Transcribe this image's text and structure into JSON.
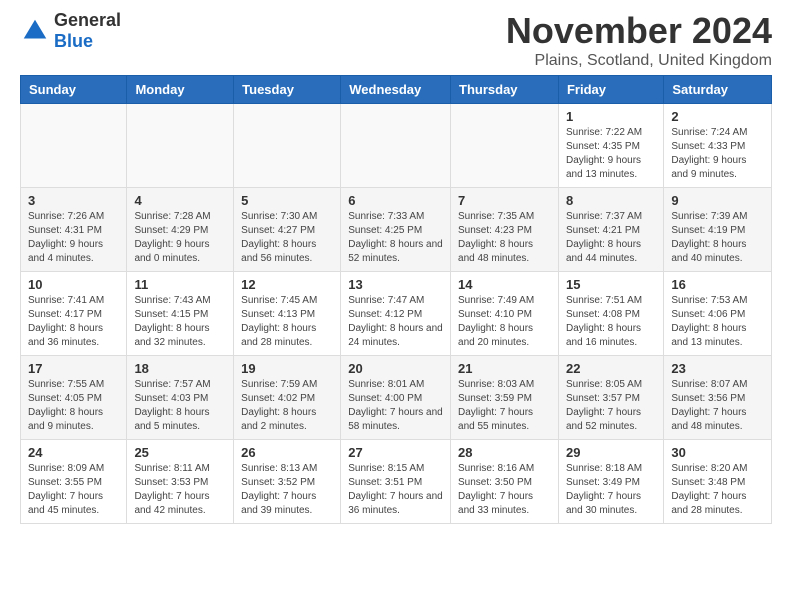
{
  "header": {
    "logo": {
      "general": "General",
      "blue": "Blue"
    },
    "title": "November 2024",
    "location": "Plains, Scotland, United Kingdom"
  },
  "calendar": {
    "days_of_week": [
      "Sunday",
      "Monday",
      "Tuesday",
      "Wednesday",
      "Thursday",
      "Friday",
      "Saturday"
    ],
    "weeks": [
      [
        {
          "day": "",
          "info": ""
        },
        {
          "day": "",
          "info": ""
        },
        {
          "day": "",
          "info": ""
        },
        {
          "day": "",
          "info": ""
        },
        {
          "day": "",
          "info": ""
        },
        {
          "day": "1",
          "info": "Sunrise: 7:22 AM\nSunset: 4:35 PM\nDaylight: 9 hours and 13 minutes."
        },
        {
          "day": "2",
          "info": "Sunrise: 7:24 AM\nSunset: 4:33 PM\nDaylight: 9 hours and 9 minutes."
        }
      ],
      [
        {
          "day": "3",
          "info": "Sunrise: 7:26 AM\nSunset: 4:31 PM\nDaylight: 9 hours and 4 minutes."
        },
        {
          "day": "4",
          "info": "Sunrise: 7:28 AM\nSunset: 4:29 PM\nDaylight: 9 hours and 0 minutes."
        },
        {
          "day": "5",
          "info": "Sunrise: 7:30 AM\nSunset: 4:27 PM\nDaylight: 8 hours and 56 minutes."
        },
        {
          "day": "6",
          "info": "Sunrise: 7:33 AM\nSunset: 4:25 PM\nDaylight: 8 hours and 52 minutes."
        },
        {
          "day": "7",
          "info": "Sunrise: 7:35 AM\nSunset: 4:23 PM\nDaylight: 8 hours and 48 minutes."
        },
        {
          "day": "8",
          "info": "Sunrise: 7:37 AM\nSunset: 4:21 PM\nDaylight: 8 hours and 44 minutes."
        },
        {
          "day": "9",
          "info": "Sunrise: 7:39 AM\nSunset: 4:19 PM\nDaylight: 8 hours and 40 minutes."
        }
      ],
      [
        {
          "day": "10",
          "info": "Sunrise: 7:41 AM\nSunset: 4:17 PM\nDaylight: 8 hours and 36 minutes."
        },
        {
          "day": "11",
          "info": "Sunrise: 7:43 AM\nSunset: 4:15 PM\nDaylight: 8 hours and 32 minutes."
        },
        {
          "day": "12",
          "info": "Sunrise: 7:45 AM\nSunset: 4:13 PM\nDaylight: 8 hours and 28 minutes."
        },
        {
          "day": "13",
          "info": "Sunrise: 7:47 AM\nSunset: 4:12 PM\nDaylight: 8 hours and 24 minutes."
        },
        {
          "day": "14",
          "info": "Sunrise: 7:49 AM\nSunset: 4:10 PM\nDaylight: 8 hours and 20 minutes."
        },
        {
          "day": "15",
          "info": "Sunrise: 7:51 AM\nSunset: 4:08 PM\nDaylight: 8 hours and 16 minutes."
        },
        {
          "day": "16",
          "info": "Sunrise: 7:53 AM\nSunset: 4:06 PM\nDaylight: 8 hours and 13 minutes."
        }
      ],
      [
        {
          "day": "17",
          "info": "Sunrise: 7:55 AM\nSunset: 4:05 PM\nDaylight: 8 hours and 9 minutes."
        },
        {
          "day": "18",
          "info": "Sunrise: 7:57 AM\nSunset: 4:03 PM\nDaylight: 8 hours and 5 minutes."
        },
        {
          "day": "19",
          "info": "Sunrise: 7:59 AM\nSunset: 4:02 PM\nDaylight: 8 hours and 2 minutes."
        },
        {
          "day": "20",
          "info": "Sunrise: 8:01 AM\nSunset: 4:00 PM\nDaylight: 7 hours and 58 minutes."
        },
        {
          "day": "21",
          "info": "Sunrise: 8:03 AM\nSunset: 3:59 PM\nDaylight: 7 hours and 55 minutes."
        },
        {
          "day": "22",
          "info": "Sunrise: 8:05 AM\nSunset: 3:57 PM\nDaylight: 7 hours and 52 minutes."
        },
        {
          "day": "23",
          "info": "Sunrise: 8:07 AM\nSunset: 3:56 PM\nDaylight: 7 hours and 48 minutes."
        }
      ],
      [
        {
          "day": "24",
          "info": "Sunrise: 8:09 AM\nSunset: 3:55 PM\nDaylight: 7 hours and 45 minutes."
        },
        {
          "day": "25",
          "info": "Sunrise: 8:11 AM\nSunset: 3:53 PM\nDaylight: 7 hours and 42 minutes."
        },
        {
          "day": "26",
          "info": "Sunrise: 8:13 AM\nSunset: 3:52 PM\nDaylight: 7 hours and 39 minutes."
        },
        {
          "day": "27",
          "info": "Sunrise: 8:15 AM\nSunset: 3:51 PM\nDaylight: 7 hours and 36 minutes."
        },
        {
          "day": "28",
          "info": "Sunrise: 8:16 AM\nSunset: 3:50 PM\nDaylight: 7 hours and 33 minutes."
        },
        {
          "day": "29",
          "info": "Sunrise: 8:18 AM\nSunset: 3:49 PM\nDaylight: 7 hours and 30 minutes."
        },
        {
          "day": "30",
          "info": "Sunrise: 8:20 AM\nSunset: 3:48 PM\nDaylight: 7 hours and 28 minutes."
        }
      ]
    ]
  }
}
